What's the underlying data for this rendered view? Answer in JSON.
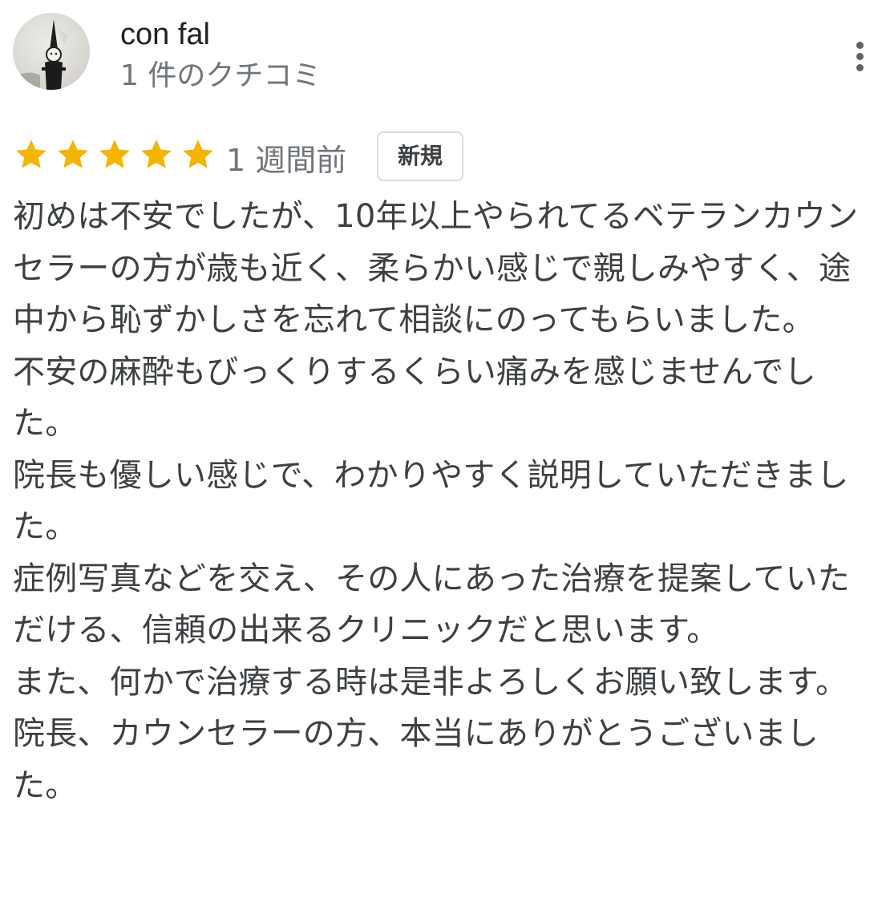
{
  "reviewer": {
    "name": "con fal",
    "review_count": "1 件のクチコミ",
    "avatar": "avatar-photo"
  },
  "more_menu": {
    "icon": "more-vert-icon"
  },
  "rating": {
    "stars": 5,
    "max_stars": 5,
    "star_icon": "star-icon",
    "star_color": "#f4b400"
  },
  "time_ago": "1 週間前",
  "badge": "新規",
  "review": {
    "paragraphs": [
      "初めは不安でしたが、10年以上やられてるベテランカウンセラーの方が歳も近く、柔らかい感じで親しみやすく、途中から恥ずかしさを忘れて相談にのってもらいました。",
      "不安の麻酔もびっくりするくらい痛みを感じませんでした。",
      "院長も優しい感じで、わかりやすく説明していただきました。",
      "症例写真などを交え、その人にあった治療を提案していただける、信頼の出来るクリニックだと思います。",
      "また、何かで治療する時は是非よろしくお願い致します。",
      "院長、カウンセラーの方、本当にありがとうございました。"
    ]
  }
}
